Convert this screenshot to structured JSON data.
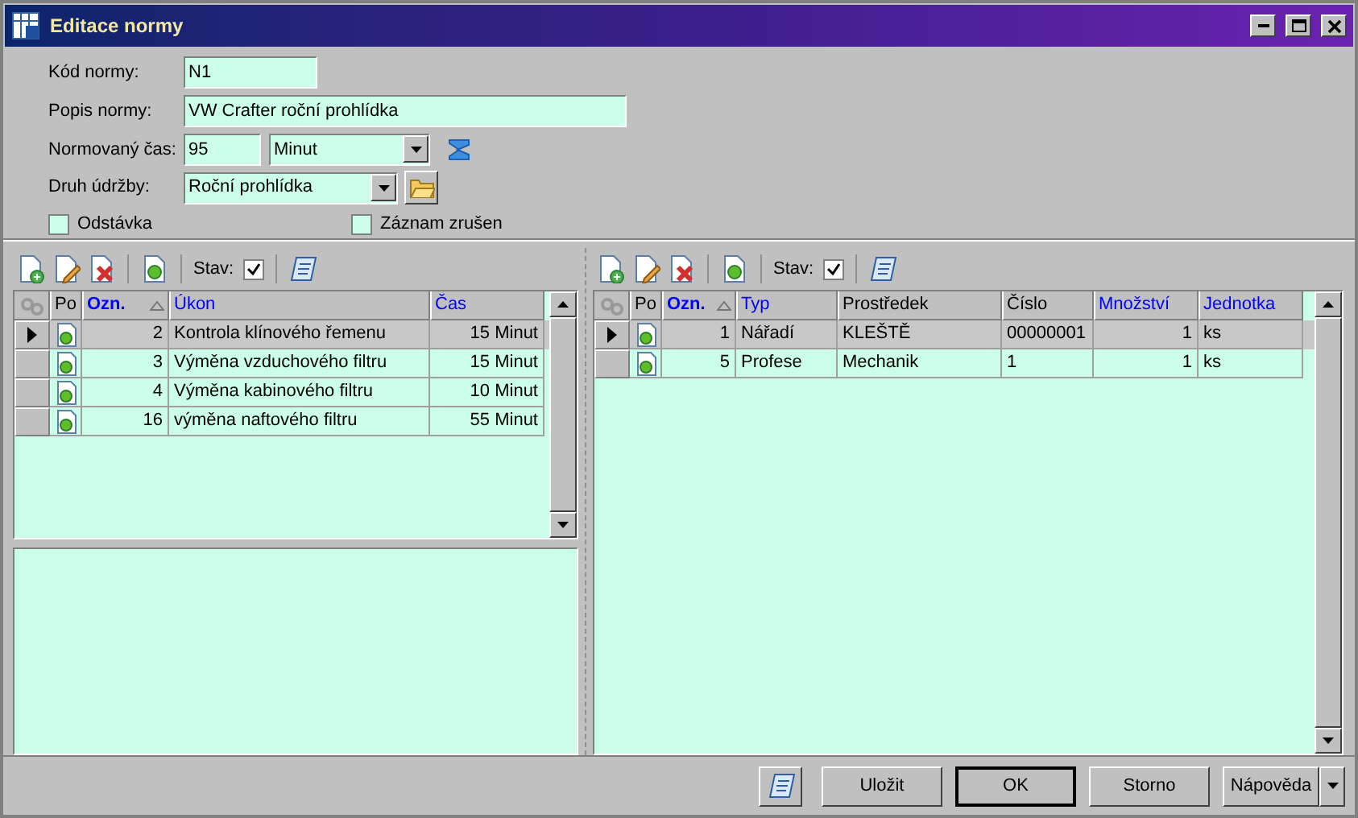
{
  "window": {
    "title": "Editace normy"
  },
  "form": {
    "code": {
      "label": "Kód normy:",
      "value": "N1"
    },
    "description": {
      "label": "Popis normy:",
      "value": "VW Crafter roční prohlídka"
    },
    "time": {
      "label": "Normovaný čas:",
      "value": "95",
      "unit": "Minut"
    },
    "maintenance_type": {
      "label": "Druh údržby:",
      "value": "Roční prohlídka"
    },
    "checkboxes": [
      {
        "label": "Odstávka",
        "checked": false
      },
      {
        "label": "Záznam zrušen",
        "checked": false
      }
    ]
  },
  "panels": [
    {
      "toolbar": {
        "state_label": "Stav:",
        "state_checked": true
      },
      "columns": [
        {
          "label": "Po",
          "kind": "icon"
        },
        {
          "label": "Ozn.",
          "kind": "sorted"
        },
        {
          "label": "Úkon",
          "kind": "link"
        },
        {
          "label": "Čas",
          "kind": "number"
        }
      ],
      "rows": [
        {
          "selected": true,
          "cells": [
            "",
            "2",
            "Kontrola klínového řemenu",
            "15 Minut"
          ]
        },
        {
          "selected": false,
          "cells": [
            "",
            "3",
            "Výměna vzduchového filtru",
            "15 Minut"
          ]
        },
        {
          "selected": false,
          "cells": [
            "",
            "4",
            "Výměna kabinového filtru",
            "10 Minut"
          ]
        },
        {
          "selected": false,
          "cells": [
            "",
            "16",
            "výměna naftového filtru",
            "55 Minut"
          ]
        }
      ]
    },
    {
      "toolbar": {
        "state_label": "Stav:",
        "state_checked": true
      },
      "columns": [
        {
          "label": "Po",
          "kind": "icon"
        },
        {
          "label": "Ozn.",
          "kind": "sorted"
        },
        {
          "label": "Typ",
          "kind": "link"
        },
        {
          "label": "Prostředek",
          "kind": "plain"
        },
        {
          "label": "Číslo",
          "kind": "plain"
        },
        {
          "label": "Množství",
          "kind": "number"
        },
        {
          "label": "Jednotka",
          "kind": "link"
        }
      ],
      "rows": [
        {
          "selected": true,
          "cells": [
            "",
            "1",
            "Nářadí",
            "KLEŠTĚ",
            "00000001",
            "1",
            "ks"
          ]
        },
        {
          "selected": false,
          "cells": [
            "",
            "5",
            "Profese",
            "Mechanik",
            "1",
            "1",
            "ks"
          ]
        }
      ]
    }
  ],
  "buttons": [
    {
      "label": "Uložit",
      "default": false
    },
    {
      "label": "OK",
      "default": true
    },
    {
      "label": "Storno",
      "default": false
    },
    {
      "label": "Nápověda",
      "default": false
    }
  ]
}
